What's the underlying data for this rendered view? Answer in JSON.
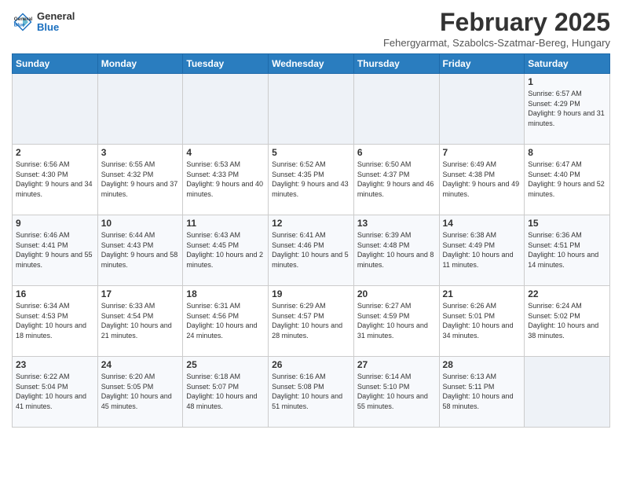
{
  "header": {
    "logo": {
      "general": "General",
      "blue": "Blue"
    },
    "title": "February 2025",
    "subtitle": "Fehergyarmat, Szabolcs-Szatmar-Bereg, Hungary"
  },
  "weekdays": [
    "Sunday",
    "Monday",
    "Tuesday",
    "Wednesday",
    "Thursday",
    "Friday",
    "Saturday"
  ],
  "weeks": [
    [
      {
        "day": null
      },
      {
        "day": null
      },
      {
        "day": null
      },
      {
        "day": null
      },
      {
        "day": null
      },
      {
        "day": null
      },
      {
        "day": 1,
        "sunrise": "6:57 AM",
        "sunset": "4:29 PM",
        "daylight": "9 hours and 31 minutes."
      }
    ],
    [
      {
        "day": 2,
        "sunrise": "6:56 AM",
        "sunset": "4:30 PM",
        "daylight": "9 hours and 34 minutes."
      },
      {
        "day": 3,
        "sunrise": "6:55 AM",
        "sunset": "4:32 PM",
        "daylight": "9 hours and 37 minutes."
      },
      {
        "day": 4,
        "sunrise": "6:53 AM",
        "sunset": "4:33 PM",
        "daylight": "9 hours and 40 minutes."
      },
      {
        "day": 5,
        "sunrise": "6:52 AM",
        "sunset": "4:35 PM",
        "daylight": "9 hours and 43 minutes."
      },
      {
        "day": 6,
        "sunrise": "6:50 AM",
        "sunset": "4:37 PM",
        "daylight": "9 hours and 46 minutes."
      },
      {
        "day": 7,
        "sunrise": "6:49 AM",
        "sunset": "4:38 PM",
        "daylight": "9 hours and 49 minutes."
      },
      {
        "day": 8,
        "sunrise": "6:47 AM",
        "sunset": "4:40 PM",
        "daylight": "9 hours and 52 minutes."
      }
    ],
    [
      {
        "day": 9,
        "sunrise": "6:46 AM",
        "sunset": "4:41 PM",
        "daylight": "9 hours and 55 minutes."
      },
      {
        "day": 10,
        "sunrise": "6:44 AM",
        "sunset": "4:43 PM",
        "daylight": "9 hours and 58 minutes."
      },
      {
        "day": 11,
        "sunrise": "6:43 AM",
        "sunset": "4:45 PM",
        "daylight": "10 hours and 2 minutes."
      },
      {
        "day": 12,
        "sunrise": "6:41 AM",
        "sunset": "4:46 PM",
        "daylight": "10 hours and 5 minutes."
      },
      {
        "day": 13,
        "sunrise": "6:39 AM",
        "sunset": "4:48 PM",
        "daylight": "10 hours and 8 minutes."
      },
      {
        "day": 14,
        "sunrise": "6:38 AM",
        "sunset": "4:49 PM",
        "daylight": "10 hours and 11 minutes."
      },
      {
        "day": 15,
        "sunrise": "6:36 AM",
        "sunset": "4:51 PM",
        "daylight": "10 hours and 14 minutes."
      }
    ],
    [
      {
        "day": 16,
        "sunrise": "6:34 AM",
        "sunset": "4:53 PM",
        "daylight": "10 hours and 18 minutes."
      },
      {
        "day": 17,
        "sunrise": "6:33 AM",
        "sunset": "4:54 PM",
        "daylight": "10 hours and 21 minutes."
      },
      {
        "day": 18,
        "sunrise": "6:31 AM",
        "sunset": "4:56 PM",
        "daylight": "10 hours and 24 minutes."
      },
      {
        "day": 19,
        "sunrise": "6:29 AM",
        "sunset": "4:57 PM",
        "daylight": "10 hours and 28 minutes."
      },
      {
        "day": 20,
        "sunrise": "6:27 AM",
        "sunset": "4:59 PM",
        "daylight": "10 hours and 31 minutes."
      },
      {
        "day": 21,
        "sunrise": "6:26 AM",
        "sunset": "5:01 PM",
        "daylight": "10 hours and 34 minutes."
      },
      {
        "day": 22,
        "sunrise": "6:24 AM",
        "sunset": "5:02 PM",
        "daylight": "10 hours and 38 minutes."
      }
    ],
    [
      {
        "day": 23,
        "sunrise": "6:22 AM",
        "sunset": "5:04 PM",
        "daylight": "10 hours and 41 minutes."
      },
      {
        "day": 24,
        "sunrise": "6:20 AM",
        "sunset": "5:05 PM",
        "daylight": "10 hours and 45 minutes."
      },
      {
        "day": 25,
        "sunrise": "6:18 AM",
        "sunset": "5:07 PM",
        "daylight": "10 hours and 48 minutes."
      },
      {
        "day": 26,
        "sunrise": "6:16 AM",
        "sunset": "5:08 PM",
        "daylight": "10 hours and 51 minutes."
      },
      {
        "day": 27,
        "sunrise": "6:14 AM",
        "sunset": "5:10 PM",
        "daylight": "10 hours and 55 minutes."
      },
      {
        "day": 28,
        "sunrise": "6:13 AM",
        "sunset": "5:11 PM",
        "daylight": "10 hours and 58 minutes."
      },
      {
        "day": null
      }
    ]
  ]
}
